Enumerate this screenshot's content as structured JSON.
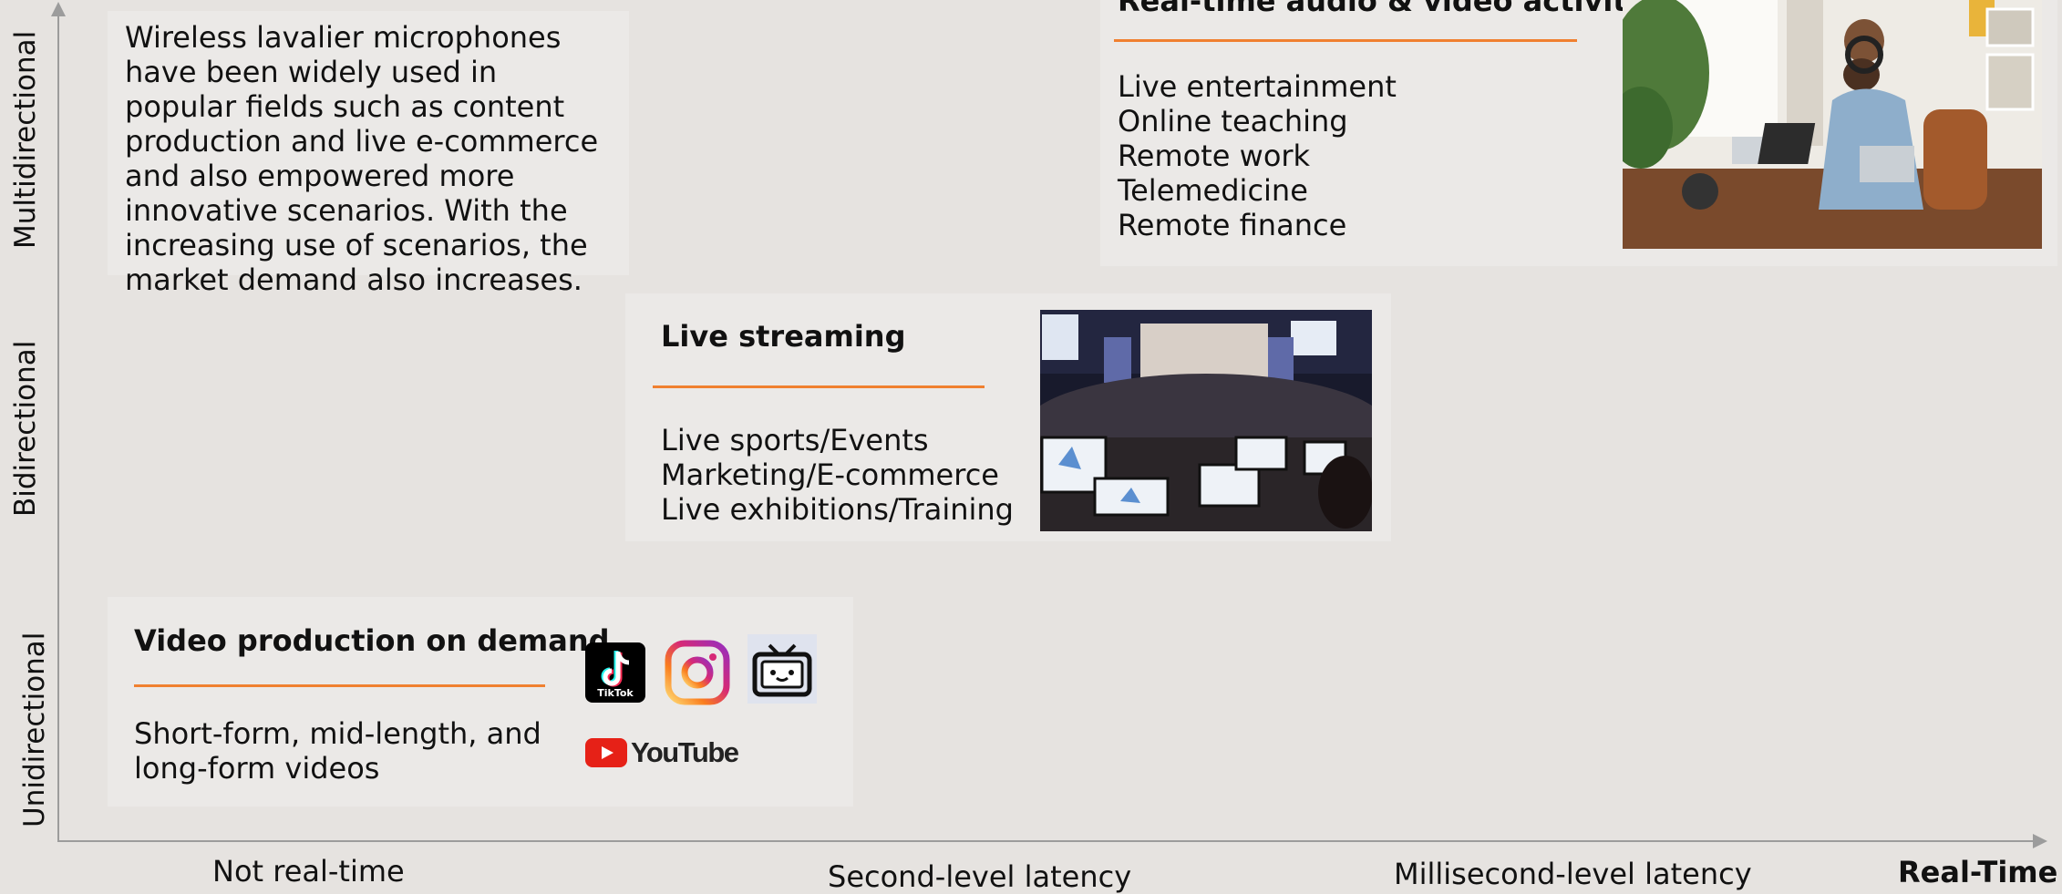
{
  "y_axis": {
    "levels": [
      "Unidirectional",
      "Bidirectional",
      "Multidirectional"
    ]
  },
  "x_axis": {
    "levels": [
      "Not real-time",
      "Second-level latency",
      "Millisecond-level latency"
    ],
    "end_label": "Real-Time"
  },
  "intro": {
    "text": "Wireless lavalier microphones have been widely used in popular fields such as content production and live e-commerce and also empowered more innovative scenarios. With the increasing use of scenarios, the market demand also increases."
  },
  "cards": {
    "realtime": {
      "title": "Real-time audio & video activity",
      "items": [
        "Live entertainment",
        "Online teaching",
        "Remote work",
        "Telemedicine",
        "Remote finance"
      ]
    },
    "streaming": {
      "title": "Live streaming",
      "items": [
        "Live sports/Events",
        "Marketing/E-commerce",
        "Live exhibitions/Training"
      ]
    },
    "vod": {
      "title": "Video production on demand",
      "desc_line1": "Short-form, mid-length, and",
      "desc_line2": "long-form videos",
      "logos": {
        "tiktok_text": "TikTok",
        "youtube_text": "YouTube"
      }
    }
  },
  "colors": {
    "accent": "#f08030",
    "axis": "#9c9c9c",
    "background": "#e6e3e0",
    "card": "#ebe9e7"
  }
}
